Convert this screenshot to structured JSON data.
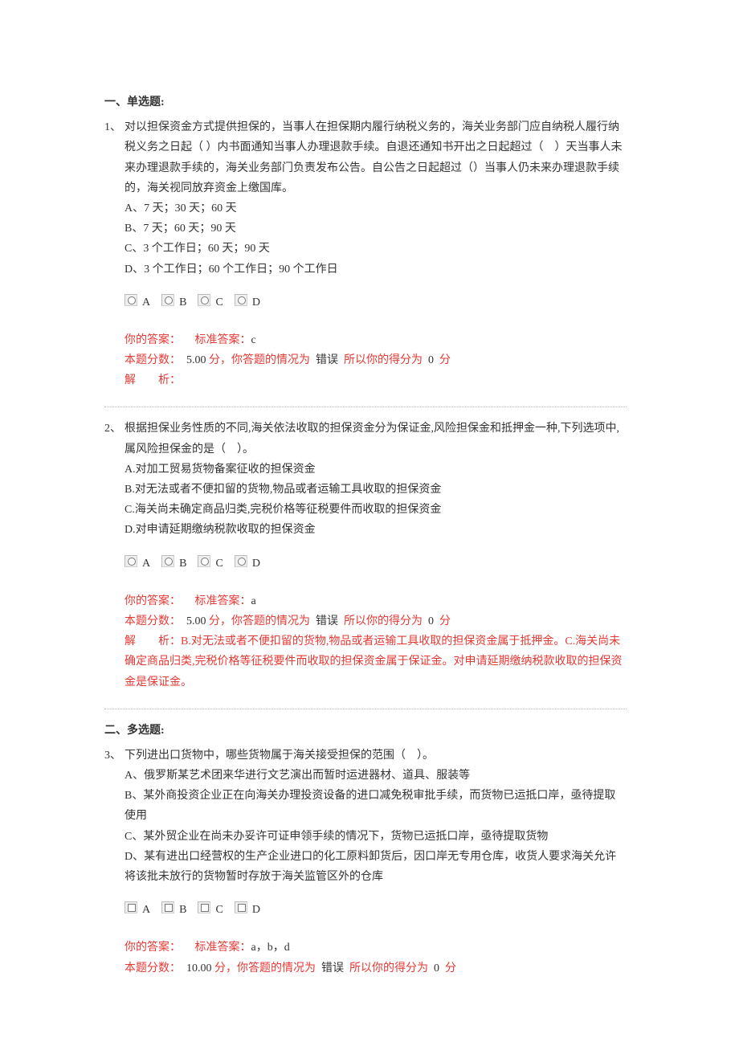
{
  "section1": {
    "title": "一、单选题:"
  },
  "q1": {
    "number": "1、",
    "text": "对以担保资金方式提供担保的，当事人在担保期内履行纳税义务的，海关业务部门应自纳税人履行纳税义务之日起（ ）内书面通知当事人办理退款手续。自退还通知书开出之日起超过（　）天当事人未来办理退款手续的，海关业务部门负责发布公告。自公告之日起超过（）当事人仍未来办理退款手续的，海关视同放弃资金上缴国库。",
    "optA": "A、7 天；30 天；60 天",
    "optB": "B、7 天；60 天；90 天",
    "optC": "C、3 个工作日；60 天；90 天",
    "optD": "D、3 个工作日；60 个工作日；90 个工作日",
    "radios": {
      "a": "A",
      "b": "B",
      "c": "C",
      "d": "D"
    },
    "ans": {
      "your_label": "你的答案：",
      "std_label": "标准答案：",
      "std_value": "c",
      "score_prefix": "本题分数：",
      "score_points": "5.00",
      "score_unit": "分，你答题的情况为",
      "status": "错误",
      "score_suffix": "所以你的得分为",
      "got": "0",
      "got_unit": "分",
      "expl_label": "解　　析：",
      "expl_text": ""
    }
  },
  "q2": {
    "number": "2、",
    "text": "根据担保业务性质的不同,海关依法收取的担保资金分为保证金,风险担保金和抵押金一种,下列选项中,属风险担保金的是（　）。",
    "optA": "A.对加工贸易货物备案征收的担保资金",
    "optB": "B.对无法或者不便扣留的货物,物品或者运输工具收取的担保资金",
    "optC": "C.海关尚未确定商品归类,完税价格等征税要件而收取的担保资金",
    "optD": "D.对申请延期缴纳税款收取的担保资金",
    "radios": {
      "a": "A",
      "b": "B",
      "c": "C",
      "d": "D"
    },
    "ans": {
      "your_label": "你的答案：",
      "std_label": "标准答案：",
      "std_value": "a",
      "score_prefix": "本题分数：",
      "score_points": "5.00",
      "score_unit": "分，你答题的情况为",
      "status": "错误",
      "score_suffix": "所以你的得分为",
      "got": "0",
      "got_unit": "分",
      "expl_label": "解　　析：",
      "expl_text": "B.对无法或者不便扣留的货物,物品或者运输工具收取的担保资金属于抵押金。C.海关尚未确定商品归类,完税价格等征税要件而收取的担保资金属于保证金。对申请延期缴纳税款收取的担保资金是保证金。"
    }
  },
  "section2": {
    "title": "二、多选题:"
  },
  "q3": {
    "number": "3、",
    "text": "下列进出口货物中，哪些货物属于海关接受担保的范围（　）。",
    "optA": "A、俄罗斯某艺术团来华进行文艺演出而暂时运进器材、道具、服装等",
    "optB": "B、某外商投资企业正在向海关办理投资设备的进口减免税审批手续，而货物已运抵口岸，亟待提取使用",
    "optC": "C、某外贸企业在尚未办妥许可证申领手续的情况下，货物已运抵口岸，亟待提取货物",
    "optD": "D、某有进出口经营权的生产企业进口的化工原料卸货后，因口岸无专用仓库，收货人要求海关允许将该批未放行的货物暂时存放于海关监管区外的仓库",
    "radios": {
      "a": "A",
      "b": "B",
      "c": "C",
      "d": "D"
    },
    "ans": {
      "your_label": "你的答案：",
      "std_label": "标准答案：",
      "std_value": "a，b，d",
      "score_prefix": "本题分数：",
      "score_points": "10.00",
      "score_unit": "分，你答题的情况为",
      "status": "错误",
      "score_suffix": "所以你的得分为",
      "got": "0",
      "got_unit": "分"
    }
  }
}
